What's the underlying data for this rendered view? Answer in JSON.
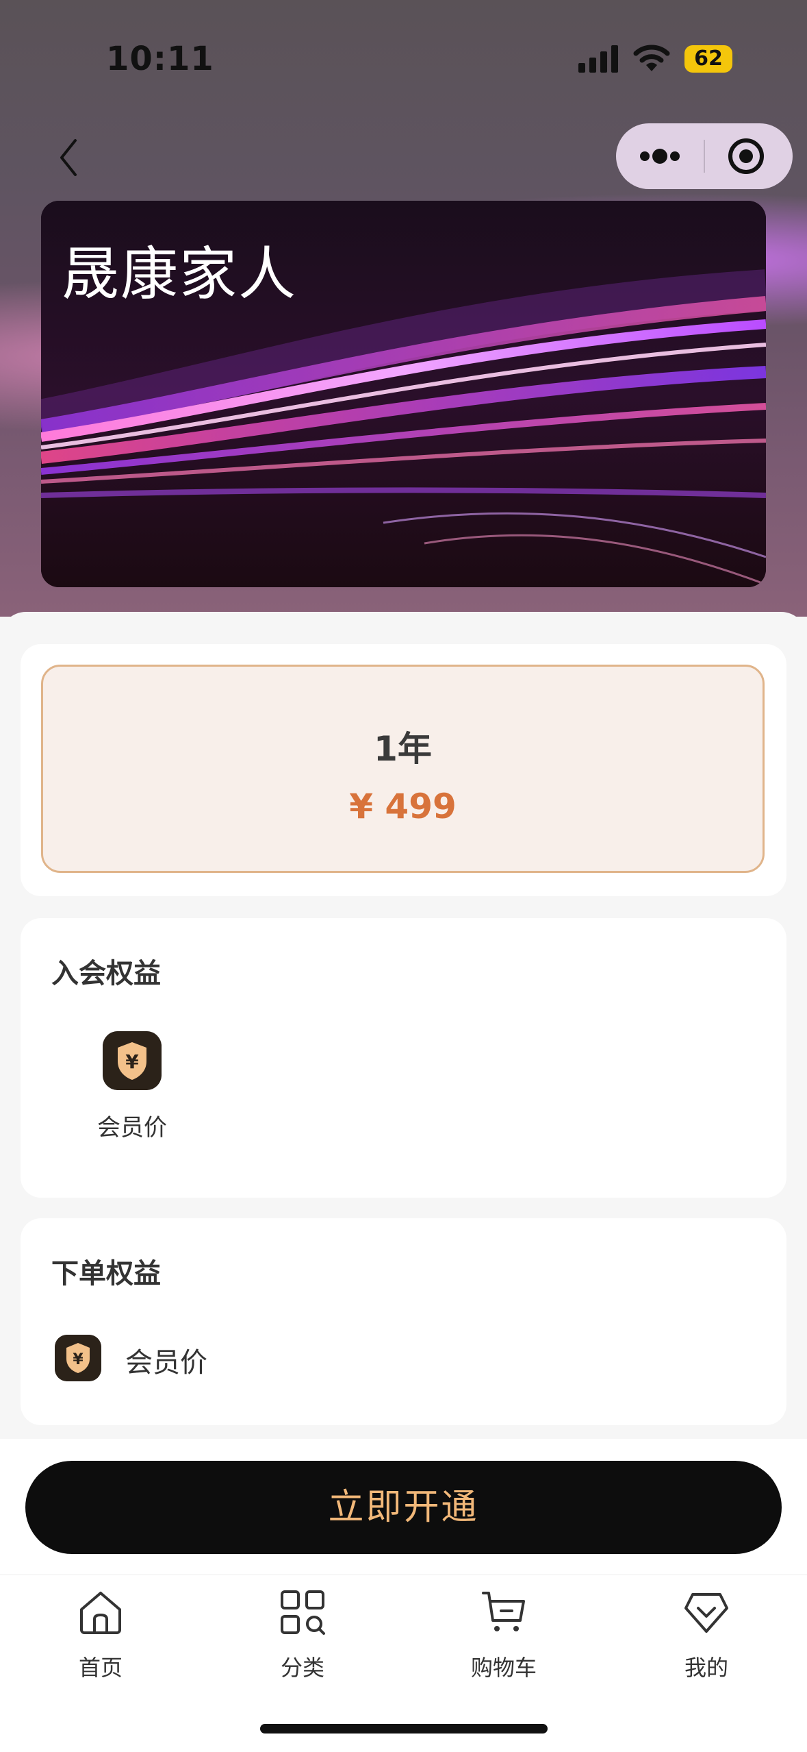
{
  "status_bar": {
    "time": "10:11",
    "battery": "62"
  },
  "card": {
    "title": "晟康家人"
  },
  "plan": {
    "duration": "1年",
    "price": "¥ 499"
  },
  "join_benefits": {
    "title": "入会权益",
    "items": [
      {
        "label": "会员价",
        "icon": "yuan-shield-icon"
      }
    ]
  },
  "order_benefits": {
    "title": "下单权益",
    "items": [
      {
        "label": "会员价",
        "icon": "yuan-shield-icon"
      }
    ]
  },
  "cta": {
    "label": "立即开通"
  },
  "tabbar": {
    "items": [
      {
        "label": "首页",
        "icon": "home-icon"
      },
      {
        "label": "分类",
        "icon": "category-icon"
      },
      {
        "label": "购物车",
        "icon": "cart-icon"
      },
      {
        "label": "我的",
        "icon": "profile-icon"
      }
    ]
  },
  "colors": {
    "accent": "#d8733b",
    "cta_text": "#f2b879",
    "plan_border": "#e0b48a",
    "plan_bg": "#f8efea"
  }
}
